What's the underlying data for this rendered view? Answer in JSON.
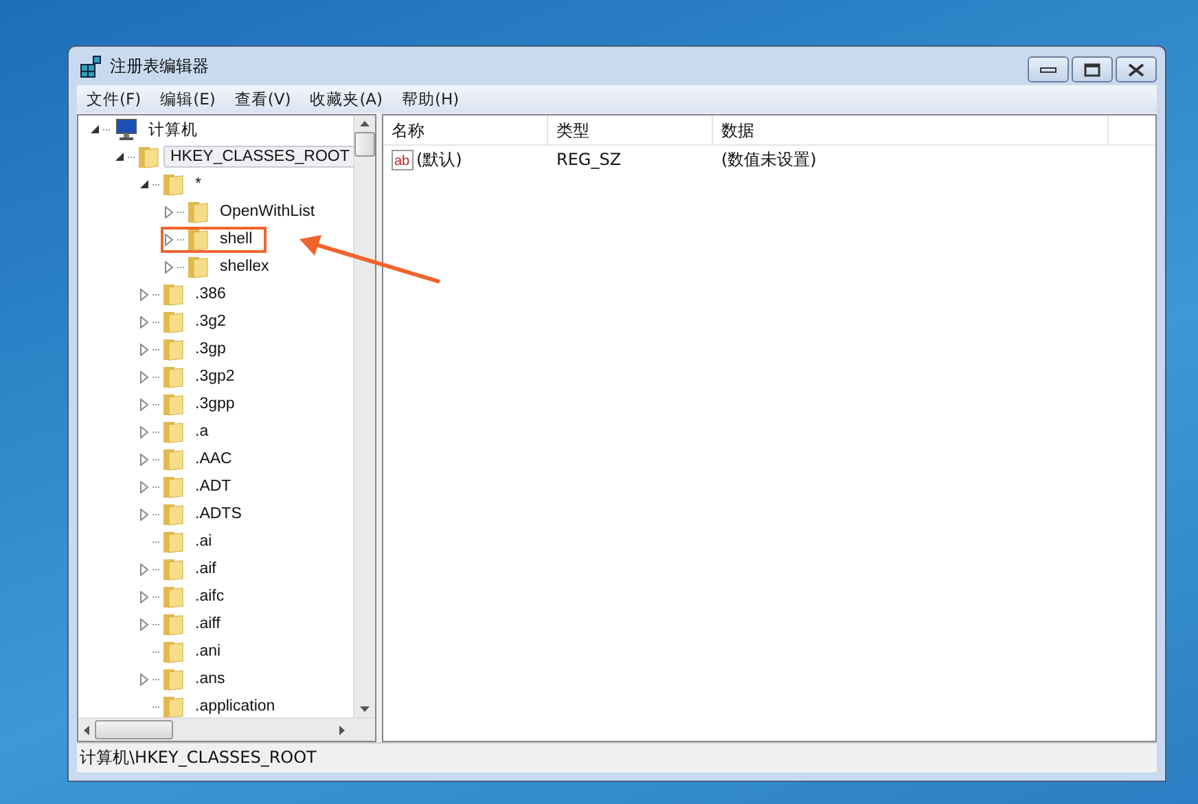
{
  "window": {
    "title": "注册表编辑器"
  },
  "menu": [
    "文件(F)",
    "编辑(E)",
    "查看(V)",
    "收藏夹(A)",
    "帮助(H)"
  ],
  "tree": [
    {
      "label": "计算机",
      "kind": "computer",
      "expandable": true,
      "expanded": true,
      "selected": false,
      "highlighted": false,
      "children": [
        {
          "label": "HKEY_CLASSES_ROOT",
          "kind": "folder",
          "expandable": true,
          "expanded": true,
          "selected": true,
          "highlighted": false,
          "children": [
            {
              "label": "*",
              "kind": "folder",
              "expandable": true,
              "expanded": true,
              "selected": false,
              "highlighted": false,
              "children": [
                {
                  "label": "OpenWithList",
                  "kind": "folder",
                  "expandable": true,
                  "expanded": false,
                  "selected": false,
                  "highlighted": false
                },
                {
                  "label": "shell",
                  "kind": "folder",
                  "expandable": true,
                  "expanded": false,
                  "selected": false,
                  "highlighted": true
                },
                {
                  "label": "shellex",
                  "kind": "folder",
                  "expandable": true,
                  "expanded": false,
                  "selected": false,
                  "highlighted": false
                }
              ]
            },
            {
              "label": ".386",
              "kind": "folder",
              "expandable": true,
              "expanded": false,
              "selected": false,
              "highlighted": false
            },
            {
              "label": ".3g2",
              "kind": "folder",
              "expandable": true,
              "expanded": false,
              "selected": false,
              "highlighted": false
            },
            {
              "label": ".3gp",
              "kind": "folder",
              "expandable": true,
              "expanded": false,
              "selected": false,
              "highlighted": false
            },
            {
              "label": ".3gp2",
              "kind": "folder",
              "expandable": true,
              "expanded": false,
              "selected": false,
              "highlighted": false
            },
            {
              "label": ".3gpp",
              "kind": "folder",
              "expandable": true,
              "expanded": false,
              "selected": false,
              "highlighted": false
            },
            {
              "label": ".a",
              "kind": "folder",
              "expandable": true,
              "expanded": false,
              "selected": false,
              "highlighted": false
            },
            {
              "label": ".AAC",
              "kind": "folder",
              "expandable": true,
              "expanded": false,
              "selected": false,
              "highlighted": false
            },
            {
              "label": ".ADT",
              "kind": "folder",
              "expandable": true,
              "expanded": false,
              "selected": false,
              "highlighted": false
            },
            {
              "label": ".ADTS",
              "kind": "folder",
              "expandable": true,
              "expanded": false,
              "selected": false,
              "highlighted": false
            },
            {
              "label": ".ai",
              "kind": "folder",
              "expandable": false,
              "selected": false,
              "highlighted": false
            },
            {
              "label": ".aif",
              "kind": "folder",
              "expandable": true,
              "expanded": false,
              "selected": false,
              "highlighted": false
            },
            {
              "label": ".aifc",
              "kind": "folder",
              "expandable": true,
              "expanded": false,
              "selected": false,
              "highlighted": false
            },
            {
              "label": ".aiff",
              "kind": "folder",
              "expandable": true,
              "expanded": false,
              "selected": false,
              "highlighted": false
            },
            {
              "label": ".ani",
              "kind": "folder",
              "expandable": false,
              "selected": false,
              "highlighted": false
            },
            {
              "label": ".ans",
              "kind": "folder",
              "expandable": true,
              "expanded": false,
              "selected": false,
              "highlighted": false
            },
            {
              "label": ".application",
              "kind": "folder",
              "expandable": false,
              "selected": false,
              "highlighted": false
            }
          ]
        }
      ]
    }
  ],
  "values_table": {
    "columns": [
      "名称",
      "类型",
      "数据"
    ],
    "rows": [
      {
        "icon_text": "ab",
        "name": "(默认)",
        "type": "REG_SZ",
        "data": "(数值未设置)"
      }
    ]
  },
  "status_bar": "计算机\\HKEY_CLASSES_ROOT"
}
